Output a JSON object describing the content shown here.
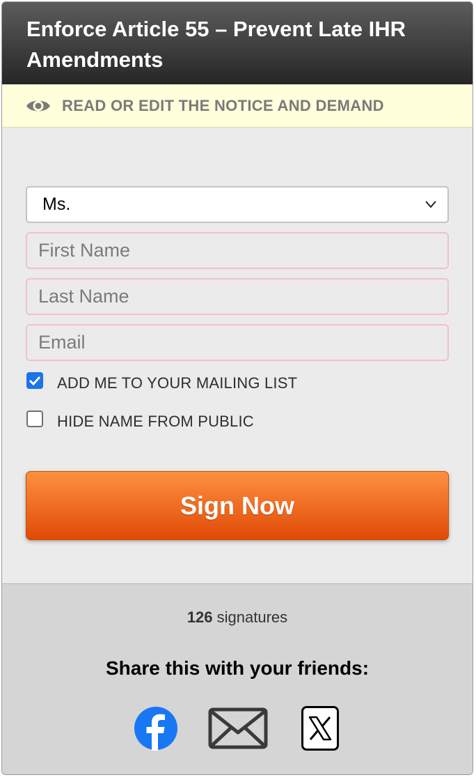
{
  "header": {
    "title": "Enforce Article 55 – Prevent Late IHR Amendments"
  },
  "notice": {
    "label": "READ OR EDIT THE NOTICE AND DEMAND",
    "icon": "eye-icon"
  },
  "form": {
    "salutation": {
      "selected": "Ms."
    },
    "first_name": {
      "placeholder": "First Name"
    },
    "last_name": {
      "placeholder": "Last Name"
    },
    "email": {
      "placeholder": "Email"
    },
    "mailing_list": {
      "label": "ADD ME TO YOUR MAILING LIST",
      "checked": true
    },
    "hide_name": {
      "label": "HIDE NAME FROM PUBLIC",
      "checked": false
    },
    "submit_label": "Sign Now"
  },
  "footer": {
    "count": "126",
    "count_suffix": "signatures",
    "share_label": "Share this with your friends:",
    "share_icons": [
      "facebook-icon",
      "email-icon",
      "x-icon"
    ]
  },
  "colors": {
    "header_top": "#5c5c5c",
    "header_bottom": "#262626",
    "notice_bg": "#ffffdc",
    "button_top": "#ff9040",
    "button_bottom": "#e04a06",
    "checkbox_checked": "#1b74e8",
    "facebook_blue": "#1877f2"
  }
}
